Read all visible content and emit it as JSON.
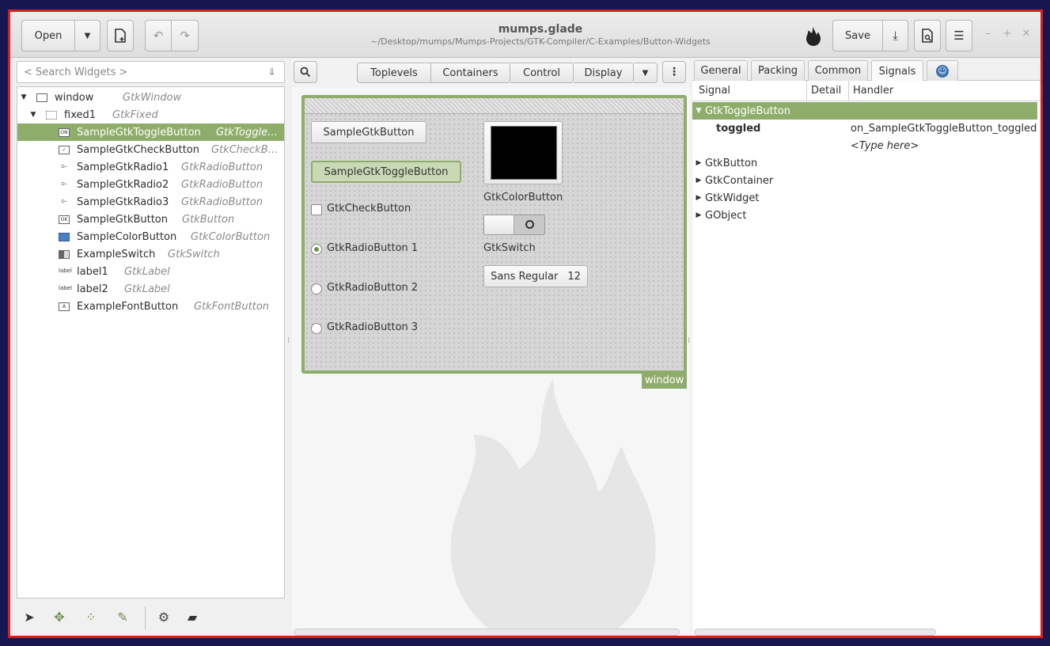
{
  "header": {
    "open_label": "Open",
    "title": "mumps.glade",
    "subtitle": "~/Desktop/mumps/Mumps-Projects/GTK-Compiler/C-Examples/Button-Widgets",
    "save_label": "Save"
  },
  "widget_search": {
    "placeholder": "< Search Widgets >"
  },
  "tree": {
    "rows": [
      {
        "name": "window",
        "class": "GtkWindow"
      },
      {
        "name": "fixed1",
        "class": "GtkFixed"
      },
      {
        "name": "SampleGtkToggleButton",
        "class": "GtkToggle…"
      },
      {
        "name": "SampleGtkCheckButton",
        "class": "GtkCheckBu…"
      },
      {
        "name": "SampleGtkRadio1",
        "class": "GtkRadioButton"
      },
      {
        "name": "SampleGtkRadio2",
        "class": "GtkRadioButton"
      },
      {
        "name": "SampleGtkRadio3",
        "class": "GtkRadioButton"
      },
      {
        "name": "SampleGtkButton",
        "class": "GtkButton"
      },
      {
        "name": "SampleColorButton",
        "class": "GtkColorButton"
      },
      {
        "name": "ExampleSwitch",
        "class": "GtkSwitch"
      },
      {
        "name": "label1",
        "class": "GtkLabel"
      },
      {
        "name": "label2",
        "class": "GtkLabel"
      },
      {
        "name": "ExampleFontButton",
        "class": "GtkFontButton"
      }
    ],
    "icon_text": {
      "toggle": "ON",
      "check": "✓",
      "button": "OK",
      "label": "label",
      "font": "A"
    }
  },
  "palette": {
    "toplevels": "Toplevels",
    "containers": "Containers",
    "control": "Control",
    "display": "Display"
  },
  "canvas": {
    "button": "SampleGtkButton",
    "toggle_button": "SampleGtkToggleButton",
    "check_button": "GtkCheckButton",
    "radio1": "GtkRadioButton 1",
    "radio2": "GtkRadioButton 2",
    "radio3": "GtkRadioButton 3",
    "color_button_label": "GtkColorButton",
    "color_value": "#000000",
    "switch_label": "GtkSwitch",
    "font_name": "Sans Regular",
    "font_size": "12",
    "window_tag": "window"
  },
  "props_tabs": {
    "general": "General",
    "packing": "Packing",
    "common": "Common",
    "signals": "Signals"
  },
  "signals": {
    "col_signal": "Signal",
    "col_detail": "Detail",
    "col_handler": "Handler",
    "selected_class": "GtkToggleButton",
    "signal_name": "toggled",
    "handler": "on_SampleGtkToggleButton_toggled",
    "type_here": "<Type here>",
    "other_classes": [
      "GtkButton",
      "GtkContainer",
      "GtkWidget",
      "GObject"
    ]
  },
  "colors": {
    "accent": "#8fad6a",
    "frame": "#e01b1b",
    "outer": "#161650"
  }
}
